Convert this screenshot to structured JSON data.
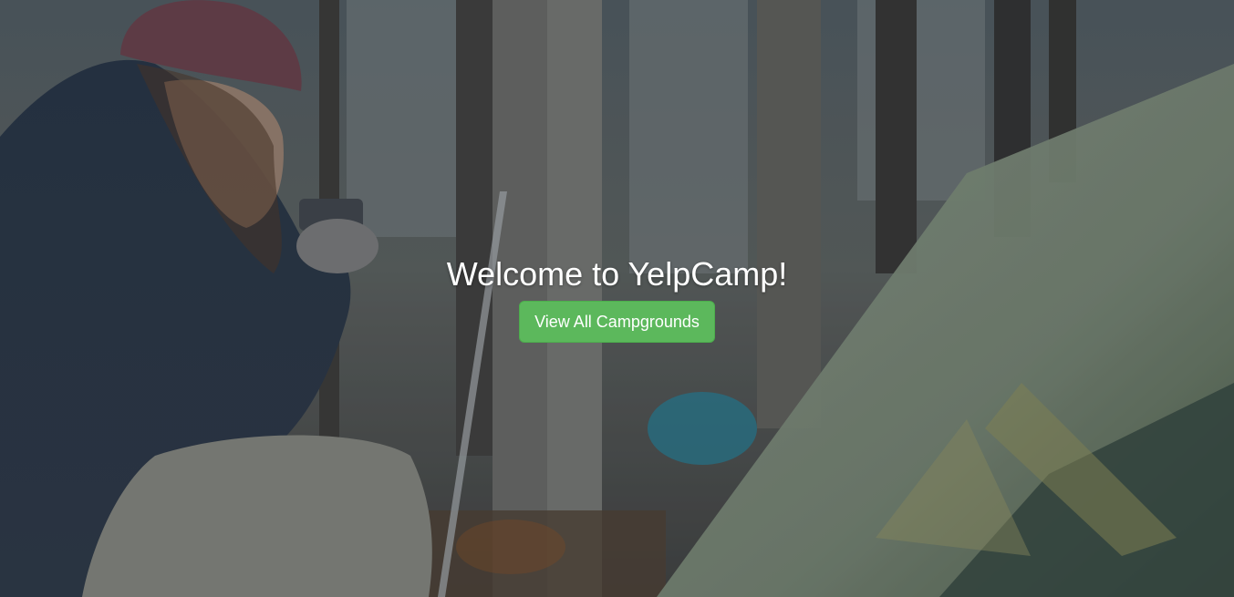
{
  "hero": {
    "title": "Welcome to YelpCamp!",
    "button_label": "View All Campgrounds"
  },
  "colors": {
    "button_bg": "#5cb85c",
    "button_border": "#4cae4c",
    "title_text": "#ffffff"
  }
}
